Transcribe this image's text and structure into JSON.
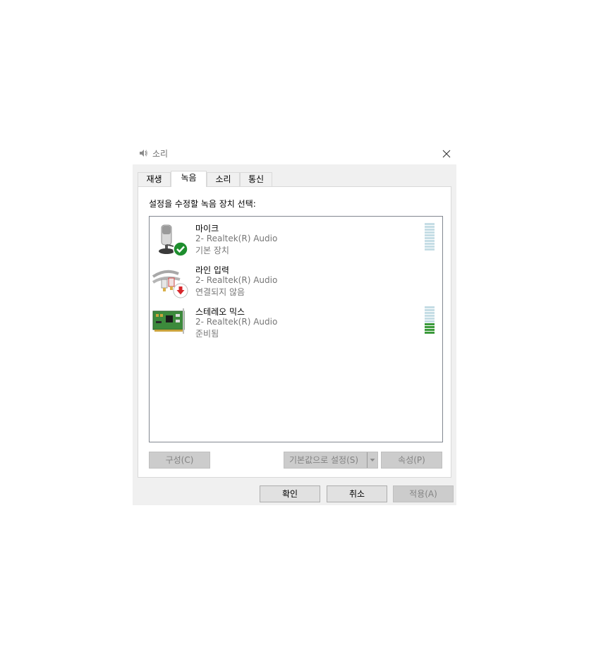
{
  "window": {
    "title": "소리",
    "close_label": "×"
  },
  "tabs": [
    {
      "label": "재생",
      "active": false
    },
    {
      "label": "녹음",
      "active": true
    },
    {
      "label": "소리",
      "active": false
    },
    {
      "label": "통신",
      "active": false
    }
  ],
  "panel": {
    "instruction": "설정을 수정할 녹음 장치 선택:",
    "devices": [
      {
        "name": "마이크",
        "driver": "2- Realtek(R) Audio",
        "status": "기본 장치",
        "icon": "microphone-icon",
        "badge": "default-check-icon",
        "meter_level": 0
      },
      {
        "name": "라인 입력",
        "driver": "2- Realtek(R) Audio",
        "status": "연결되지 않음",
        "icon": "line-in-cable-icon",
        "badge": "unplugged-arrow-icon",
        "meter_level": null
      },
      {
        "name": "스테레오 믹스",
        "driver": "2- Realtek(R) Audio",
        "status": "준비됨",
        "icon": "sound-card-icon",
        "badge": null,
        "meter_level": 0.4
      }
    ],
    "buttons": {
      "configure": "구성(C)",
      "set_default": "기본값으로 설정(S)",
      "properties": "속성(P)"
    }
  },
  "footer": {
    "ok": "확인",
    "cancel": "취소",
    "apply": "적용(A)"
  },
  "colors": {
    "meter_empty": "#c5dde5",
    "meter_active": "#3b9a3b",
    "check_green": "#1e8e2e",
    "unplug_red": "#d7262b"
  }
}
